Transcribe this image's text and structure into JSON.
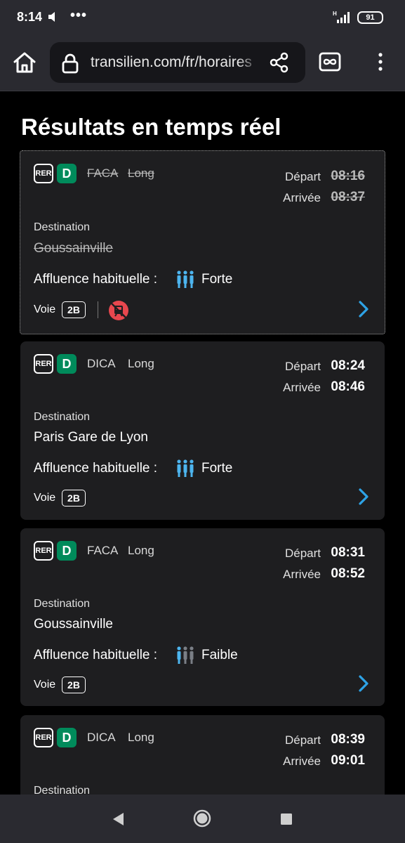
{
  "status_bar": {
    "time": "8:14",
    "dots": "•••",
    "network": "H",
    "battery": "91"
  },
  "browser": {
    "url": "transilien.com/fr/horaires"
  },
  "page": {
    "title": "Résultats en temps réel"
  },
  "labels": {
    "rer": "RER",
    "departure": "Départ",
    "arrival": "Arrivée",
    "destination": "Destination",
    "affluence": "Affluence habituelle :",
    "voie": "Voie"
  },
  "colors": {
    "line_d": "#008b5b",
    "accent_blue": "#2ea3e6",
    "alert_red": "#e8474e",
    "background": "#000000",
    "card": "#1e1e20"
  },
  "trains": [
    {
      "line": "D",
      "mission": "FACA",
      "type": "Long",
      "departure": "08:16",
      "arrival": "08:37",
      "destination": "Goussainville",
      "affluence": "Forte",
      "voie": "2B",
      "cancelled": true,
      "icon": "train-cancelled-icon"
    },
    {
      "line": "D",
      "mission": "DICA",
      "type": "Long",
      "departure": "08:24",
      "arrival": "08:46",
      "destination": "Paris Gare de Lyon",
      "affluence": "Forte",
      "voie": "2B",
      "cancelled": false
    },
    {
      "line": "D",
      "mission": "FACA",
      "type": "Long",
      "departure": "08:31",
      "arrival": "08:52",
      "destination": "Goussainville",
      "affluence": "Faible",
      "voie": "2B",
      "cancelled": false
    },
    {
      "line": "D",
      "mission": "DICA",
      "type": "Long",
      "departure": "08:39",
      "arrival": "09:01",
      "destination": "",
      "affluence": "",
      "voie": "",
      "cancelled": false
    }
  ]
}
